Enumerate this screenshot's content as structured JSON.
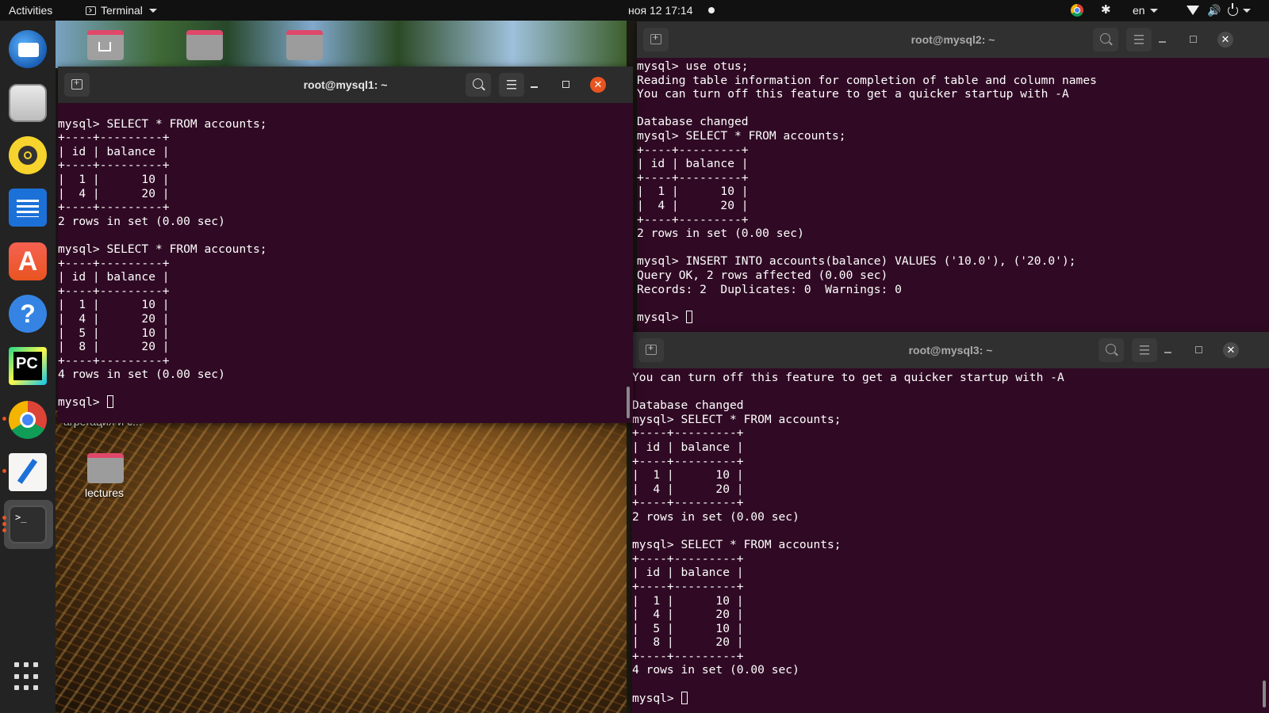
{
  "topbar": {
    "activities": "Activities",
    "app_name": "Terminal",
    "clock": "ноя 12  17:14",
    "language": "en"
  },
  "dock": {
    "items": [
      "thunderbird-icon",
      "files-icon",
      "rhythmbox-icon",
      "libreoffice-writer-icon",
      "ubuntu-software-icon",
      "help-icon",
      "pycharm-icon",
      "chrome-icon",
      "text-editor-icon",
      "terminal-icon",
      "show-apps-icon"
    ],
    "terminal_glyph": ">_"
  },
  "desktop": {
    "icons": [
      {
        "label": "агрегация и с..."
      },
      {
        "label": "lectures"
      }
    ]
  },
  "windows": {
    "mysql1": {
      "title": "root@mysql1: ~",
      "lines": [
        "",
        "mysql> SELECT * FROM accounts;",
        "+----+---------+",
        "| id | balance |",
        "+----+---------+",
        "|  1 |      10 |",
        "|  4 |      20 |",
        "+----+---------+",
        "2 rows in set (0.00 sec)",
        "",
        "mysql> SELECT * FROM accounts;",
        "+----+---------+",
        "| id | balance |",
        "+----+---------+",
        "|  1 |      10 |",
        "|  4 |      20 |",
        "|  5 |      10 |",
        "|  8 |      20 |",
        "+----+---------+",
        "4 rows in set (0.00 sec)",
        "",
        "mysql> "
      ]
    },
    "mysql2": {
      "title": "root@mysql2: ~",
      "lines": [
        "mysql> use otus;",
        "Reading table information for completion of table and column names",
        "You can turn off this feature to get a quicker startup with -A",
        "",
        "Database changed",
        "mysql> SELECT * FROM accounts;",
        "+----+---------+",
        "| id | balance |",
        "+----+---------+",
        "|  1 |      10 |",
        "|  4 |      20 |",
        "+----+---------+",
        "2 rows in set (0.00 sec)",
        "",
        "mysql> INSERT INTO accounts(balance) VALUES ('10.0'), ('20.0');",
        "Query OK, 2 rows affected (0.00 sec)",
        "Records: 2  Duplicates: 0  Warnings: 0",
        "",
        "mysql> "
      ]
    },
    "mysql3": {
      "title": "root@mysql3: ~",
      "lines": [
        "You can turn off this feature to get a quicker startup with -A",
        "",
        "Database changed",
        "mysql> SELECT * FROM accounts;",
        "+----+---------+",
        "| id | balance |",
        "+----+---------+",
        "|  1 |      10 |",
        "|  4 |      20 |",
        "+----+---------+",
        "2 rows in set (0.00 sec)",
        "",
        "mysql> SELECT * FROM accounts;",
        "+----+---------+",
        "| id | balance |",
        "+----+---------+",
        "|  1 |      10 |",
        "|  4 |      20 |",
        "|  5 |      10 |",
        "|  8 |      20 |",
        "+----+---------+",
        "4 rows in set (0.00 sec)",
        "",
        "mysql> "
      ]
    }
  },
  "colors": {
    "terminal_bg": "#300a24",
    "terminal_fg": "#ffffff",
    "titlebar_bg": "#2c2c2c",
    "accent_close": "#e95420",
    "topbar_bg": "#111111",
    "dock_bg": "#232323"
  }
}
